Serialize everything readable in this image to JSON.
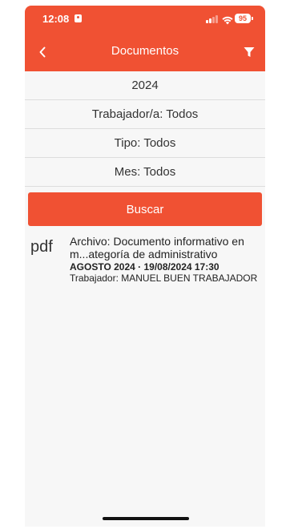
{
  "status_bar": {
    "time": "12:08",
    "battery": "95"
  },
  "nav": {
    "title": "Documentos",
    "back_icon": "chevron-left-icon",
    "filter_icon": "filter-icon"
  },
  "filters": [
    {
      "label": "2024"
    },
    {
      "label": "Trabajador/a: Todos"
    },
    {
      "label": "Tipo: Todos"
    },
    {
      "label": "Mes: Todos"
    }
  ],
  "search_button": "Buscar",
  "documents": [
    {
      "type": "pdf",
      "title": "Archivo: Documento informativo en m...ategoría de administrativo",
      "date": "AGOSTO 2024 · 19/08/2024 17:30",
      "worker": "Trabajador: MANUEL BUEN TRABAJADOR"
    }
  ],
  "colors": {
    "accent": "#f05133",
    "background": "#f7f7f7"
  }
}
